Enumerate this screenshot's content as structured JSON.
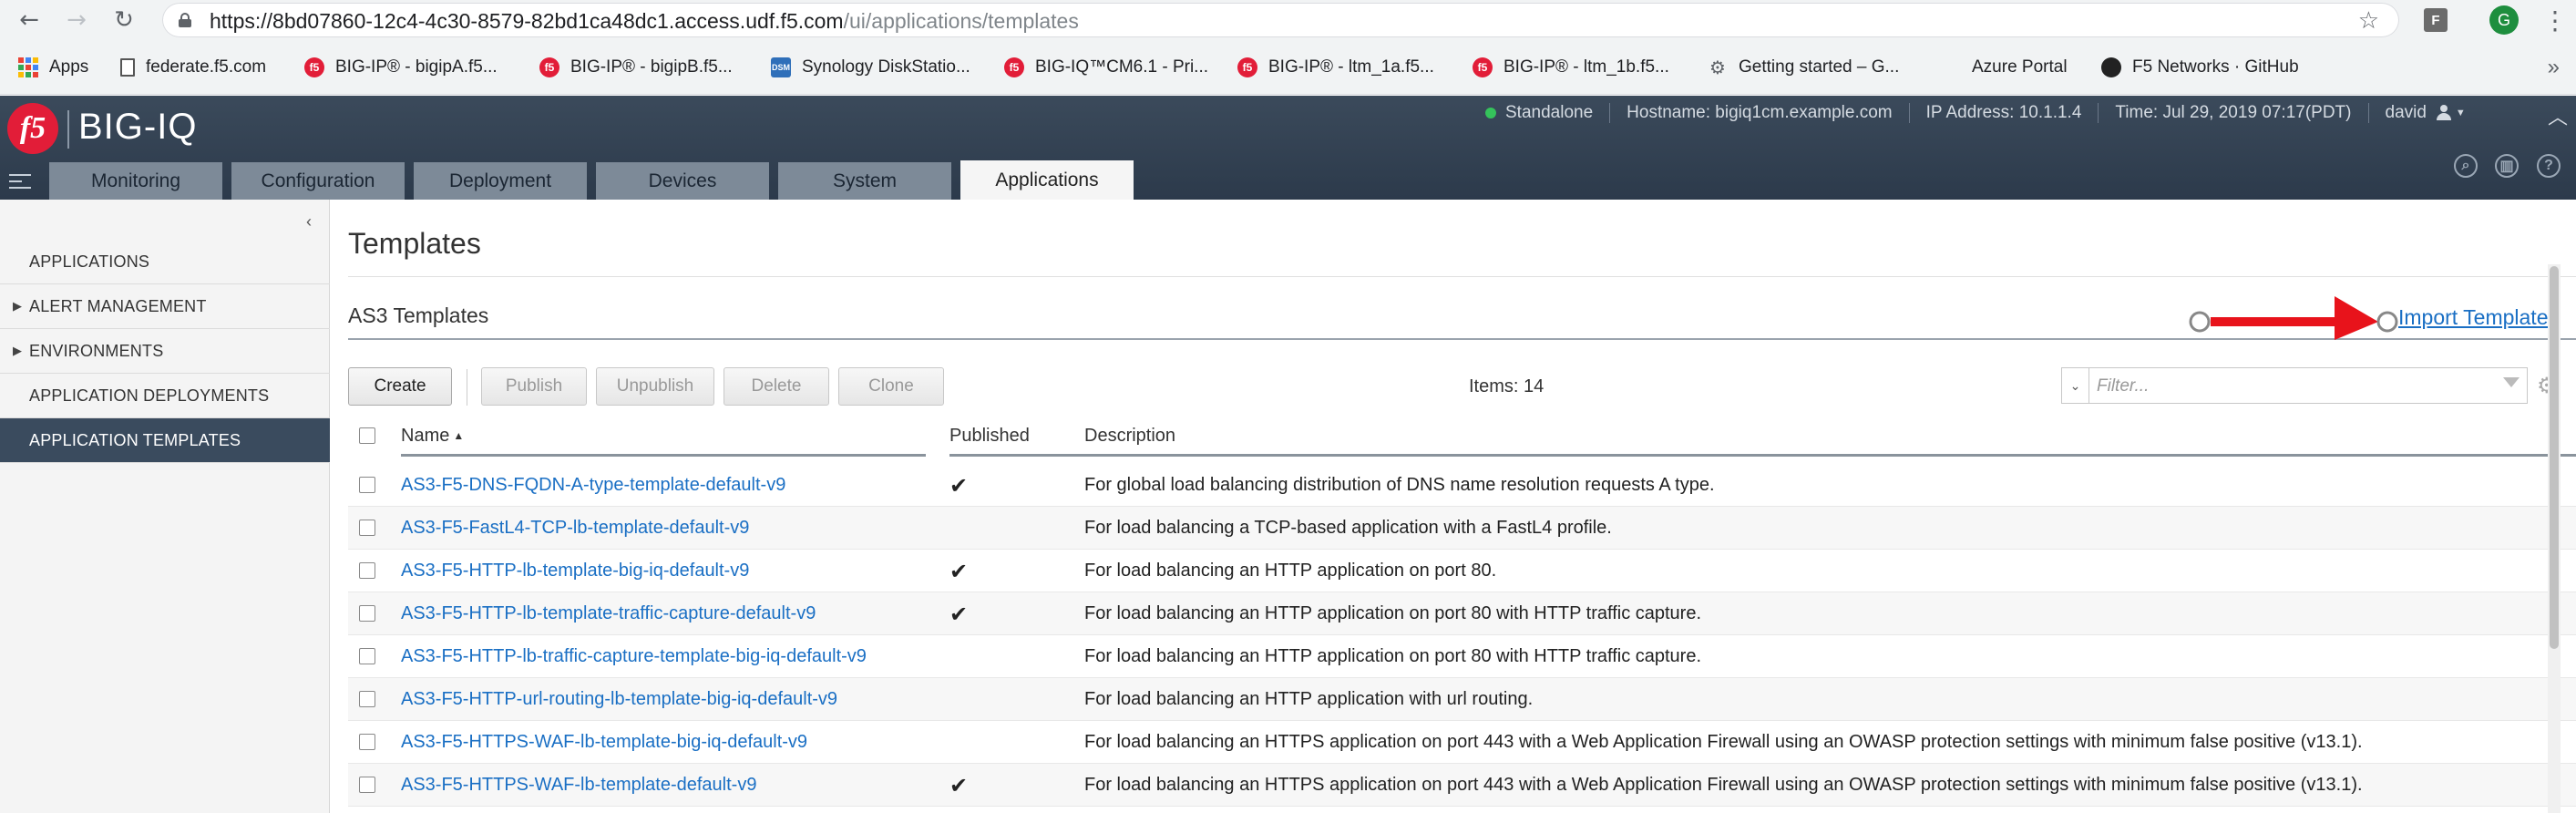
{
  "browser": {
    "url_host": "https://8bd07860-12c4-4c30-8579-82bd1ca48dc1.access.udf.f5.com",
    "url_path": "/ui/applications/templates",
    "profile_initial": "G",
    "extension_label": "F"
  },
  "bookmarks": [
    {
      "label": "Apps",
      "icon": "apps-grid-icon"
    },
    {
      "label": "federate.f5.com",
      "icon": "page-icon"
    },
    {
      "label": "BIG-IP® - bigipA.f5...",
      "icon": "f5-icon"
    },
    {
      "label": "BIG-IP® - bigipB.f5...",
      "icon": "f5-icon"
    },
    {
      "label": "Synology DiskStatio...",
      "icon": "dsm-icon"
    },
    {
      "label": "BIG-IQ™CM6.1 - Pri...",
      "icon": "f5-icon"
    },
    {
      "label": "BIG-IP® - ltm_1a.f5...",
      "icon": "f5-icon"
    },
    {
      "label": "BIG-IP® - ltm_1b.f5...",
      "icon": "f5-icon"
    },
    {
      "label": "Getting started – G...",
      "icon": "gear-icon"
    },
    {
      "label": "Azure Portal",
      "icon": "windows-icon"
    },
    {
      "label": "F5 Networks · GitHub",
      "icon": "github-icon"
    }
  ],
  "header": {
    "logo_text": "f5",
    "product": "BIG-IQ",
    "mode": "Standalone",
    "hostname": "Hostname: bigiq1cm.example.com",
    "ip": "IP Address: 10.1.1.4",
    "time": "Time: Jul 29, 2019 07:17(PDT)",
    "user": "david",
    "tabs": [
      {
        "label": "Monitoring",
        "active": false
      },
      {
        "label": "Configuration",
        "active": false
      },
      {
        "label": "Deployment",
        "active": false
      },
      {
        "label": "Devices",
        "active": false
      },
      {
        "label": "System",
        "active": false
      },
      {
        "label": "Applications",
        "active": true
      }
    ]
  },
  "sidebar": {
    "items": [
      {
        "label": "APPLICATIONS",
        "expandable": false,
        "active": false
      },
      {
        "label": "ALERT MANAGEMENT",
        "expandable": true,
        "active": false
      },
      {
        "label": "ENVIRONMENTS",
        "expandable": true,
        "active": false
      },
      {
        "label": "APPLICATION DEPLOYMENTS",
        "expandable": false,
        "active": false
      },
      {
        "label": "APPLICATION TEMPLATES",
        "expandable": false,
        "active": true
      }
    ]
  },
  "main": {
    "title": "Templates",
    "section_title": "AS3 Templates",
    "import_link": "Import Templates",
    "buttons": [
      {
        "label": "Create",
        "enabled": true
      },
      {
        "label": "Publish",
        "enabled": false
      },
      {
        "label": "Unpublish",
        "enabled": false
      },
      {
        "label": "Delete",
        "enabled": false
      },
      {
        "label": "Clone",
        "enabled": false
      }
    ],
    "items_count": "Items: 14",
    "filter_placeholder": "Filter...",
    "columns": {
      "name": "Name",
      "sort_indicator": "▲",
      "published": "Published",
      "description": "Description"
    },
    "rows": [
      {
        "name": "AS3-F5-DNS-FQDN-A-type-template-default-v9",
        "published": true,
        "description": "For global load balancing distribution of DNS name resolution requests A type."
      },
      {
        "name": "AS3-F5-FastL4-TCP-lb-template-default-v9",
        "published": false,
        "description": "For load balancing a TCP-based application with a FastL4 profile."
      },
      {
        "name": "AS3-F5-HTTP-lb-template-big-iq-default-v9",
        "published": true,
        "description": "For load balancing an HTTP application on port 80."
      },
      {
        "name": "AS3-F5-HTTP-lb-template-traffic-capture-default-v9",
        "published": true,
        "description": "For load balancing an HTTP application on port 80 with HTTP traffic capture."
      },
      {
        "name": "AS3-F5-HTTP-lb-traffic-capture-template-big-iq-default-v9",
        "published": false,
        "description": "For load balancing an HTTP application on port 80 with HTTP traffic capture."
      },
      {
        "name": "AS3-F5-HTTP-url-routing-lb-template-big-iq-default-v9",
        "published": false,
        "description": "For load balancing an HTTP application with url routing."
      },
      {
        "name": "AS3-F5-HTTPS-WAF-lb-template-big-iq-default-v9",
        "published": false,
        "description": "For load balancing an HTTPS application on port 443 with a Web Application Firewall using an OWASP protection settings with minimum false positive (v13.1)."
      },
      {
        "name": "AS3-F5-HTTPS-WAF-lb-template-default-v9",
        "published": true,
        "description": "For load balancing an HTTPS application on port 443 with a Web Application Firewall using an OWASP protection settings with minimum false positive (v13.1)."
      }
    ],
    "published_glyph": "✔"
  },
  "colors": {
    "annotation_arrow": "#e8131b",
    "link": "#1a6fc4",
    "sidebar_active": "#3a4b5e",
    "f5_red": "#e21d38"
  }
}
